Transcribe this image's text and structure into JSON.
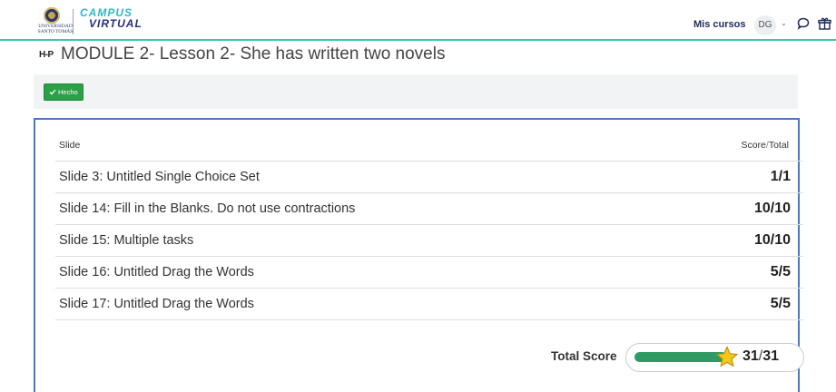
{
  "header": {
    "university_name_line1": "UNIVERSIDAD",
    "university_name_line2": "SANTO TOMÁS",
    "campus_line1": "CAMPUS",
    "campus_line2": "VIRTUAL",
    "my_courses": "Mis cursos",
    "avatar_initials": "DG",
    "caret": "⌄"
  },
  "page": {
    "icon_text": "H-P",
    "title": "MODULE 2- Lesson 2- She has written two novels",
    "done_badge": "Hecho"
  },
  "results": {
    "col_slide": "Slide",
    "col_score": "Score",
    "col_sep": "/",
    "col_total": "Total",
    "rows": [
      {
        "slide": "Slide 3: Untitled Single Choice Set",
        "score": "1/1"
      },
      {
        "slide": "Slide 14: Fill in the Blanks. Do not use contractions",
        "score": "10/10"
      },
      {
        "slide": "Slide 15: Multiple tasks",
        "score": "10/10"
      },
      {
        "slide": "Slide 16: Untitled Drag the Words",
        "score": "5/5"
      },
      {
        "slide": "Slide 17: Untitled Drag the Words",
        "score": "5/5"
      }
    ],
    "total_label": "Total Score",
    "total_score": "31",
    "total_sep": "/",
    "total_max": "31",
    "progress_fraction": 1.0
  },
  "colors": {
    "accent_teal": "#3cc4b4",
    "frame_blue": "#4a76c6",
    "done_green": "#2c9f47",
    "progress_green": "#2f9a63",
    "star_yellow": "#f5c518"
  }
}
